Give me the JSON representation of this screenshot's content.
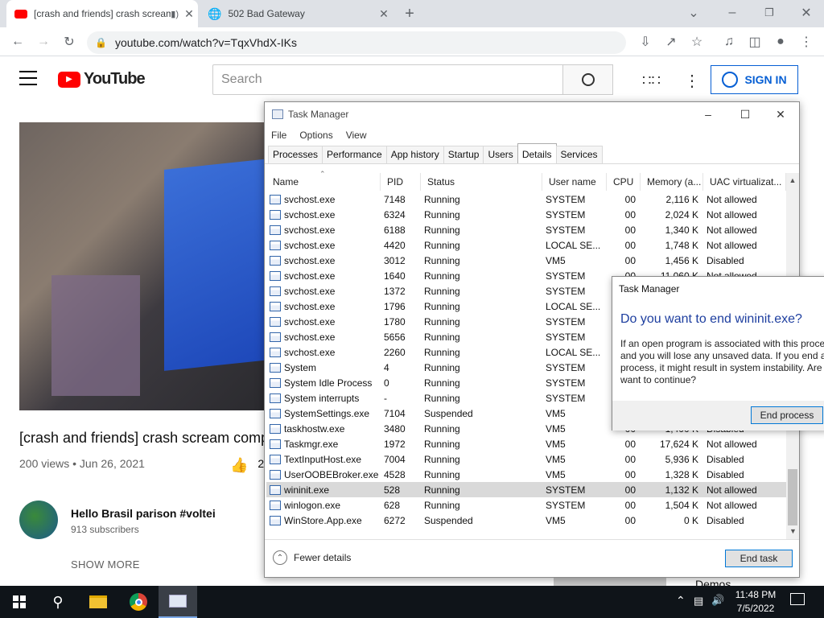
{
  "browser": {
    "tabs": [
      {
        "title": "[crash and friends] crash scream comp",
        "active": true
      },
      {
        "title": "502 Bad Gateway",
        "active": false
      }
    ],
    "url": "youtube.com/watch?v=TqxVhdX-IKs"
  },
  "youtube": {
    "logo_text": "YouTube",
    "search_placeholder": "Search",
    "signin_label": "SIGN IN",
    "video_title": "[crash and friends] crash scream comp",
    "video_meta": "200 views • Jun 26, 2021",
    "like_count": "2",
    "channel_name": "Hello Brasil parison #voltei",
    "channel_subs": "913 subscribers",
    "show_more": "SHOW MORE",
    "behind_text": "Demos"
  },
  "task_manager": {
    "title": "Task Manager",
    "menu": [
      "File",
      "Options",
      "View"
    ],
    "tabs": [
      "Processes",
      "Performance",
      "App history",
      "Startup",
      "Users",
      "Details",
      "Services"
    ],
    "active_tab": "Details",
    "columns": [
      "Name",
      "PID",
      "Status",
      "User name",
      "CPU",
      "Memory (a...",
      "UAC virtualizat..."
    ],
    "rows": [
      [
        "svchost.exe",
        "7148",
        "Running",
        "SYSTEM",
        "00",
        "2,116 K",
        "Not allowed"
      ],
      [
        "svchost.exe",
        "6324",
        "Running",
        "SYSTEM",
        "00",
        "2,024 K",
        "Not allowed"
      ],
      [
        "svchost.exe",
        "6188",
        "Running",
        "SYSTEM",
        "00",
        "1,340 K",
        "Not allowed"
      ],
      [
        "svchost.exe",
        "4420",
        "Running",
        "LOCAL SE...",
        "00",
        "1,748 K",
        "Not allowed"
      ],
      [
        "svchost.exe",
        "3012",
        "Running",
        "VM5",
        "00",
        "1,456 K",
        "Disabled"
      ],
      [
        "svchost.exe",
        "1640",
        "Running",
        "SYSTEM",
        "00",
        "11,060 K",
        "Not allowed"
      ],
      [
        "svchost.exe",
        "1372",
        "Running",
        "SYSTEM",
        "00",
        "",
        ""
      ],
      [
        "svchost.exe",
        "1796",
        "Running",
        "LOCAL SE...",
        "00",
        "",
        ""
      ],
      [
        "svchost.exe",
        "1780",
        "Running",
        "SYSTEM",
        "00",
        "",
        ""
      ],
      [
        "svchost.exe",
        "5656",
        "Running",
        "SYSTEM",
        "00",
        "",
        ""
      ],
      [
        "svchost.exe",
        "2260",
        "Running",
        "LOCAL SE...",
        "00",
        "",
        ""
      ],
      [
        "System",
        "4",
        "Running",
        "SYSTEM",
        "00",
        "",
        ""
      ],
      [
        "System Idle Process",
        "0",
        "Running",
        "SYSTEM",
        "00",
        "",
        ""
      ],
      [
        "System interrupts",
        "-",
        "Running",
        "SYSTEM",
        "00",
        "",
        ""
      ],
      [
        "SystemSettings.exe",
        "7104",
        "Suspended",
        "VM5",
        "00",
        "",
        ""
      ],
      [
        "taskhostw.exe",
        "3480",
        "Running",
        "VM5",
        "00",
        "1,400 K",
        "Disabled"
      ],
      [
        "Taskmgr.exe",
        "1972",
        "Running",
        "VM5",
        "00",
        "17,624 K",
        "Not allowed"
      ],
      [
        "TextInputHost.exe",
        "7004",
        "Running",
        "VM5",
        "00",
        "5,936 K",
        "Disabled"
      ],
      [
        "UserOOBEBroker.exe",
        "4528",
        "Running",
        "VM5",
        "00",
        "1,328 K",
        "Disabled"
      ],
      [
        "wininit.exe",
        "528",
        "Running",
        "SYSTEM",
        "00",
        "1,132 K",
        "Not allowed"
      ],
      [
        "winlogon.exe",
        "628",
        "Running",
        "SYSTEM",
        "00",
        "1,504 K",
        "Not allowed"
      ],
      [
        "WinStore.App.exe",
        "6272",
        "Suspended",
        "VM5",
        "00",
        "0 K",
        "Disabled"
      ]
    ],
    "selected_row": 19,
    "fewer_details": "Fewer details",
    "end_task": "End task"
  },
  "dialog": {
    "title": "Task Manager",
    "heading": "Do you want to end wininit.exe?",
    "message": "If an open program is associated with this process, it will close and you will lose any unsaved data. If you end a system process, it might result in system instability. Are you sure you want to continue?",
    "message_visible": "If an open program is associated with this proce and you will lose any unsaved data. If you end a process, it might result in system instability. Are want to continue?",
    "button": "End process"
  },
  "taskbar": {
    "time": "11:48 PM",
    "date": "7/5/2022"
  }
}
